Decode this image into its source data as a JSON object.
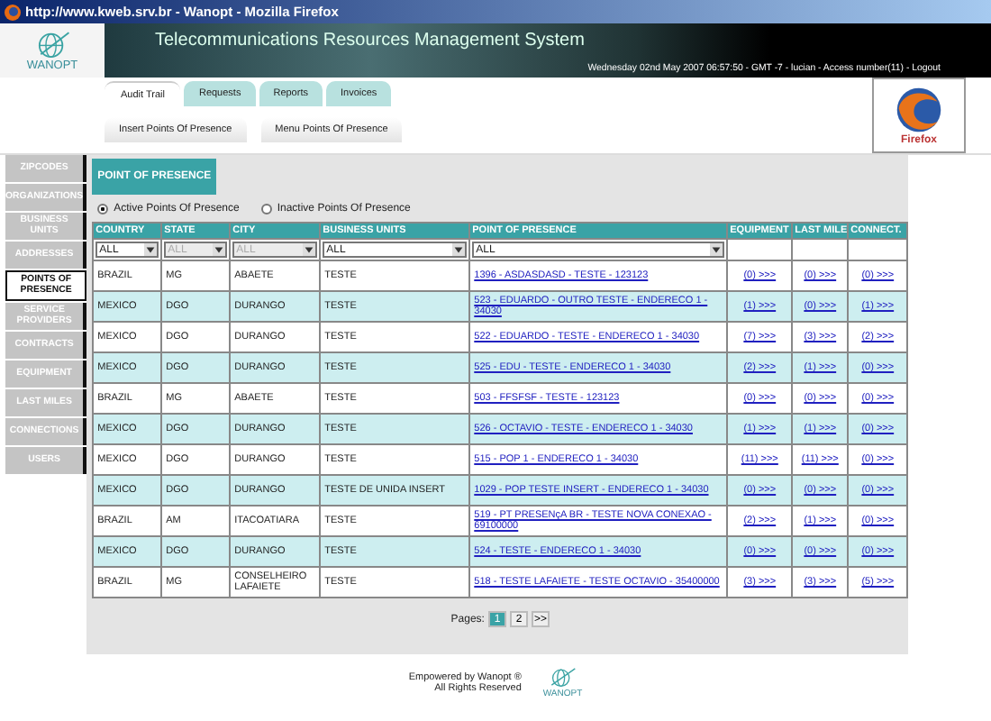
{
  "window": {
    "title": "http://www.kweb.srv.br - Wanopt - Mozilla Firefox"
  },
  "header": {
    "logo": "WANOPT",
    "system_title": "Telecommunications Resources Management System",
    "status_line": "Wednesday 02nd May 2007 06:57:50 - GMT -7 - lucian - Access number(11) - Logout"
  },
  "tabs": [
    {
      "label": "Audit Trail",
      "selected": true
    },
    {
      "label": "Requests",
      "selected": false
    },
    {
      "label": "Reports",
      "selected": false
    },
    {
      "label": "Invoices",
      "selected": false
    }
  ],
  "subtabs": [
    {
      "label": "Insert Points Of Presence"
    },
    {
      "label": "Menu Points Of Presence"
    }
  ],
  "badge": {
    "label": "Firefox"
  },
  "sidebar": {
    "items": [
      {
        "label": "ZIPCODES",
        "selected": false
      },
      {
        "label": "ORGANIZATIONS",
        "selected": false
      },
      {
        "label": "BUSINESS UNITS",
        "selected": false
      },
      {
        "label": "ADDRESSES",
        "selected": false
      },
      {
        "label": "POINTS OF PRESENCE",
        "selected": true
      },
      {
        "label": "SERVICE PROVIDERS",
        "selected": false
      },
      {
        "label": "CONTRACTS",
        "selected": false
      },
      {
        "label": "EQUIPMENT",
        "selected": false
      },
      {
        "label": "LAST MILES",
        "selected": false
      },
      {
        "label": "CONNECTIONS",
        "selected": false
      },
      {
        "label": "USERS",
        "selected": false
      }
    ]
  },
  "section_title": "POINT OF PRESENCE",
  "radios": [
    {
      "label": "Active Points Of Presence",
      "selected": true
    },
    {
      "label": "Inactive Points Of Presence",
      "selected": false
    }
  ],
  "table": {
    "columns": [
      {
        "label": "COUNTRY",
        "filter": {
          "value": "ALL",
          "disabled": false
        }
      },
      {
        "label": "STATE",
        "filter": {
          "value": "ALL",
          "disabled": true
        }
      },
      {
        "label": "CITY",
        "filter": {
          "value": "ALL",
          "disabled": true
        }
      },
      {
        "label": "BUSINESS UNITS",
        "filter": {
          "value": "ALL",
          "disabled": false
        }
      },
      {
        "label": "POINT OF PRESENCE",
        "filter": {
          "value": "ALL",
          "disabled": false
        }
      },
      {
        "label": "EQUIPMENT"
      },
      {
        "label": "LAST MILE"
      },
      {
        "label": "CONNECT."
      }
    ],
    "rows": [
      [
        "BRAZIL",
        "MG",
        "ABAETE",
        "TESTE",
        "1396 - ASDASDASD - TESTE - 123123",
        "(0) >>>",
        "(0) >>>",
        "(0) >>>"
      ],
      [
        "MEXICO",
        "DGO",
        "DURANGO",
        "TESTE",
        "523 - EDUARDO - OUTRO TESTE - ENDERECO 1 - 34030",
        "(1) >>>",
        "(0) >>>",
        "(1) >>>"
      ],
      [
        "MEXICO",
        "DGO",
        "DURANGO",
        "TESTE",
        "522 - EDUARDO - TESTE - ENDERECO 1 - 34030",
        "(7) >>>",
        "(3) >>>",
        "(2) >>>"
      ],
      [
        "MEXICO",
        "DGO",
        "DURANGO",
        "TESTE",
        "525 - EDU - TESTE - ENDERECO 1 - 34030",
        "(2) >>>",
        "(1) >>>",
        "(0) >>>"
      ],
      [
        "BRAZIL",
        "MG",
        "ABAETE",
        "TESTE",
        "503 - FFSFSF - TESTE - 123123",
        "(0) >>>",
        "(0) >>>",
        "(0) >>>"
      ],
      [
        "MEXICO",
        "DGO",
        "DURANGO",
        "TESTE",
        "526 - OCTAVIO - TESTE - ENDERECO 1 - 34030",
        "(1) >>>",
        "(1) >>>",
        "(0) >>>"
      ],
      [
        "MEXICO",
        "DGO",
        "DURANGO",
        "TESTE",
        "515 - POP 1 - ENDERECO 1 - 34030",
        "(11) >>>",
        "(11) >>>",
        "(0) >>>"
      ],
      [
        "MEXICO",
        "DGO",
        "DURANGO",
        "TESTE DE UNIDA INSERT",
        "1029 - POP TESTE INSERT - ENDERECO 1 - 34030",
        "(0) >>>",
        "(0) >>>",
        "(0) >>>"
      ],
      [
        "BRAZIL",
        "AM",
        "ITACOATIARA",
        "TESTE",
        "519 - PT PRESENçA BR - TESTE NOVA CONEXAO - 69100000",
        "(2) >>>",
        "(1) >>>",
        "(0) >>>"
      ],
      [
        "MEXICO",
        "DGO",
        "DURANGO",
        "TESTE",
        "524 - TESTE - ENDERECO 1 - 34030",
        "(0) >>>",
        "(0) >>>",
        "(0) >>>"
      ],
      [
        "BRAZIL",
        "MG",
        "CONSELHEIRO LAFAIETE",
        "TESTE",
        "518 - TESTE LAFAIETE - TESTE OCTAVIO - 35400000",
        "(3) >>>",
        "(3) >>>",
        "(5) >>>"
      ]
    ]
  },
  "pager": {
    "label": "Pages:",
    "pages": [
      {
        "label": "1",
        "selected": true
      },
      {
        "label": "2",
        "selected": false
      },
      {
        "label": ">>",
        "selected": false
      }
    ]
  },
  "footer": {
    "line1": "Empowered by Wanopt ®",
    "line2": "All Rights Reserved",
    "logo": "WANOPT"
  }
}
